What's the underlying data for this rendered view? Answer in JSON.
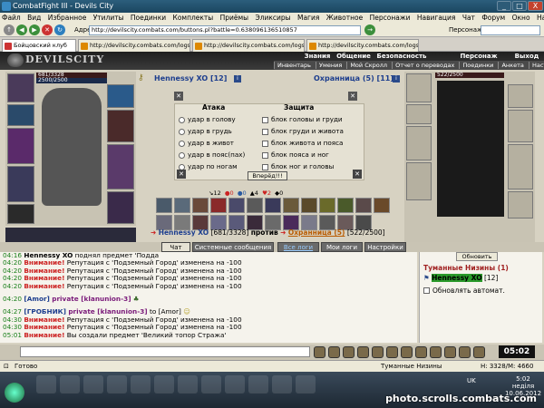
{
  "window": {
    "title": "CombatFight III - Devils City",
    "minimize": "_",
    "maximize": "□",
    "close": "X"
  },
  "menu": [
    "Файл",
    "Вид",
    "Избранное",
    "Утилиты",
    "Поединки",
    "Комплекты",
    "Приёмы",
    "Эликсиры",
    "Магия",
    "Животное",
    "Персонажи",
    "Навигация",
    "Чат",
    "Форум",
    "Окно",
    "Настройки",
    "?"
  ],
  "address": {
    "label": "Адрес:",
    "url": "http://devilscity.combats.com/buttons.pl?battle=0.638096136510857",
    "persona_label": "Персонаж:"
  },
  "tabs": [
    {
      "label": "Бойцовский клуб",
      "active": true
    },
    {
      "label": "http://devilscity.combats.com/logs.pl?l",
      "active": false
    },
    {
      "label": "http://devilscity.combats.com/logs.pl?l",
      "active": false
    },
    {
      "label": "http://devilscity.combats.com/logs.pl?l",
      "active": false
    }
  ],
  "game": {
    "logo": "DEVILSCITY",
    "topnav": [
      "Знания",
      "Общение",
      "Безопасность",
      "Персонаж",
      "Выход"
    ],
    "subnav": [
      "Инвентарь",
      "Умения",
      "Мой Скролл",
      "Отчет о переводах",
      "Поединки",
      "Анкета",
      "Настройки"
    ],
    "left_hp": "681/3328",
    "left_mana": "2500/2500",
    "right_hp": "522/2500",
    "player": {
      "name": "Hennessy XO",
      "level": "[12]"
    },
    "enemy": {
      "name": "Охранница (5)",
      "level": "[11]"
    },
    "fight": {
      "attack_title": "Атака",
      "defense_title": "Защита",
      "attacks": [
        "удар в голову",
        "удар в грудь",
        "удар в живот",
        "удар в пояс(пах)",
        "удар по ногам"
      ],
      "blocks": [
        "блок головы и груди",
        "блок груди и живота",
        "блок живота и пояса",
        "блок пояса и ног",
        "блок ног и головы"
      ],
      "submit": "Вперёд!!!"
    },
    "stats": [
      "12",
      "0",
      "0",
      "4",
      "2",
      "0"
    ],
    "versus": {
      "p1": "Hennessy XO",
      "p1_hp": "[681/3328]",
      "middle": "против",
      "p2": "Охранница (5)",
      "p2_hp": "[522/2500]"
    }
  },
  "chat": {
    "tabs": [
      {
        "label": "Чат",
        "active": true
      },
      {
        "label": "Системные сообщения",
        "active": false
      },
      {
        "label": "Все логи",
        "active": false
      },
      {
        "label": "Мои логи",
        "active": false
      },
      {
        "label": "Настройки",
        "active": false
      }
    ],
    "lines": [
      {
        "time": "04:16",
        "name": "Hennessy XO",
        "text": "поднял предмет 'Подда"
      },
      {
        "time": "04:20",
        "warn": "Внимание!",
        "text": "Репутация с 'Подземный Город' изменена на -100"
      },
      {
        "time": "04:20",
        "warn": "Внимание!",
        "text": "Репутация с 'Подземный Город' изменена на -100"
      },
      {
        "time": "04:20",
        "warn": "Внимание!",
        "text": "Репутация с 'Подземный Город' изменена на -100"
      },
      {
        "time": "04:20",
        "warn": "Внимание!",
        "text": "Репутация с 'Подземный Город' изменена на -100"
      }
    ],
    "private1": {
      "time": "04:20",
      "from": "[Amor]",
      "text": "private [klanunion-3]"
    },
    "private2": {
      "time": "04:27",
      "from": "[ГРОБНИК]",
      "text": "private [klanunion-3]",
      "to": "to [Amor]"
    },
    "lines2": [
      {
        "time": "04:30",
        "warn": "Внимание!",
        "text": "Репутация с 'Подземный Город' изменена на -100"
      },
      {
        "time": "04:30",
        "warn": "Внимание!",
        "text": "Репутация с 'Подземный Город' изменена на -100"
      },
      {
        "time": "05:01",
        "warn": "Внимание!",
        "text": "Вы создали предмет 'Великий топор Стража'"
      }
    ]
  },
  "side": {
    "refresh": "Обновить",
    "location": "Туманные Низины (1)",
    "member": "Hennessy XO",
    "member_level": "[12]",
    "auto_update": "Обновлять автомат."
  },
  "clock": "05:02",
  "status": {
    "left": "Готово",
    "location": "Туманные Низины",
    "hp": "H: 3328/M: 4660"
  },
  "taskbar": {
    "lang": "UK",
    "time": "5:02",
    "day": "неділя",
    "date": "10.06.2012"
  },
  "watermark": "photo.scrolls.combats.com"
}
